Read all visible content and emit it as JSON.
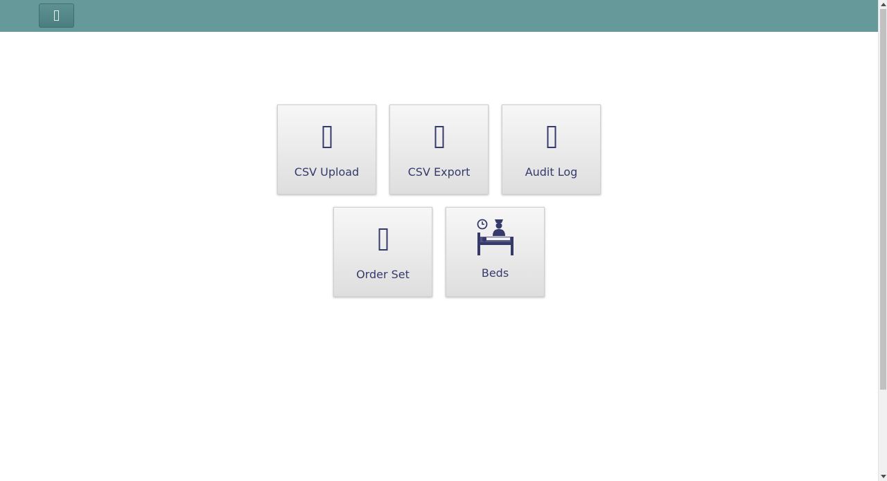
{
  "colors": {
    "header_bg": "#669999",
    "icon_and_text": "#353a6b"
  },
  "header": {
    "menu_icon": "menu-icon"
  },
  "tiles": [
    {
      "label": "CSV Upload",
      "icon": "upload-icon"
    },
    {
      "label": "CSV Export",
      "icon": "download-icon"
    },
    {
      "label": "Audit Log",
      "icon": "log-icon"
    },
    {
      "label": "Order Set",
      "icon": "list-icon"
    },
    {
      "label": "Beds",
      "icon": "hospital-bed-icon"
    }
  ]
}
